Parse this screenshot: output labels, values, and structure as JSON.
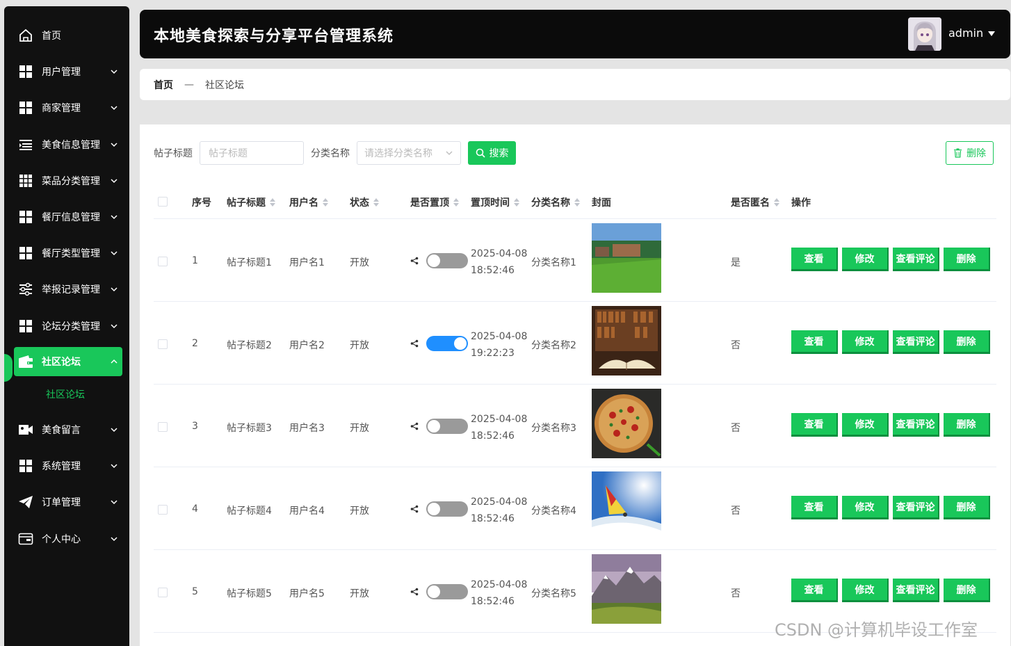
{
  "app": {
    "title": "本地美食探索与分享平台管理系统",
    "username": "admin"
  },
  "sidebar": {
    "items": [
      {
        "label": "首页",
        "icon": "home-icon"
      },
      {
        "label": "用户管理",
        "icon": "grid-icon"
      },
      {
        "label": "商家管理",
        "icon": "grid-icon"
      },
      {
        "label": "美食信息管理",
        "icon": "list-icon"
      },
      {
        "label": "菜品分类管理",
        "icon": "grid-icon"
      },
      {
        "label": "餐厅信息管理",
        "icon": "grid-icon"
      },
      {
        "label": "餐厅类型管理",
        "icon": "grid-icon"
      },
      {
        "label": "举报记录管理",
        "icon": "sliders-icon"
      },
      {
        "label": "论坛分类管理",
        "icon": "grid-icon"
      },
      {
        "label": "社区论坛",
        "icon": "wallet-icon"
      },
      {
        "label": "美食留言",
        "icon": "video-icon"
      },
      {
        "label": "系统管理",
        "icon": "grid-icon"
      },
      {
        "label": "订单管理",
        "icon": "send-icon"
      },
      {
        "label": "个人中心",
        "icon": "card-icon"
      }
    ],
    "sub_item": "社区论坛"
  },
  "breadcrumb": {
    "home": "首页",
    "separator": "—",
    "current": "社区论坛"
  },
  "search": {
    "title_label": "帖子标题",
    "title_placeholder": "帖子标题",
    "category_label": "分类名称",
    "category_placeholder": "请选择分类名称",
    "search_button": "搜索",
    "delete_button": "删除"
  },
  "table": {
    "headers": {
      "index": "序号",
      "title": "帖子标题",
      "username": "用户名",
      "status": "状态",
      "pinned": "是否置顶",
      "pinned_time": "置顶时间",
      "category": "分类名称",
      "cover": "封面",
      "anonymous": "是否匿名",
      "actions": "操作"
    },
    "rows": [
      {
        "index": "1",
        "title": "帖子标题1",
        "username": "用户名1",
        "status": "开放",
        "pinned": false,
        "date": "2025-04-08",
        "time": "18:52:46",
        "category": "分类名称1",
        "anonymous": "是",
        "cover": "campus-lawn"
      },
      {
        "index": "2",
        "title": "帖子标题2",
        "username": "用户名2",
        "status": "开放",
        "pinned": true,
        "date": "2025-04-08",
        "time": "19:22:23",
        "category": "分类名称2",
        "anonymous": "否",
        "cover": "library-book"
      },
      {
        "index": "3",
        "title": "帖子标题3",
        "username": "用户名3",
        "status": "开放",
        "pinned": false,
        "date": "2025-04-08",
        "time": "18:52:46",
        "category": "分类名称3",
        "anonymous": "否",
        "cover": "pizza"
      },
      {
        "index": "4",
        "title": "帖子标题4",
        "username": "用户名4",
        "status": "开放",
        "pinned": false,
        "date": "2025-04-08",
        "time": "18:52:46",
        "category": "分类名称4",
        "anonymous": "否",
        "cover": "windsurf"
      },
      {
        "index": "5",
        "title": "帖子标题5",
        "username": "用户名5",
        "status": "开放",
        "pinned": false,
        "date": "2025-04-08",
        "time": "18:52:46",
        "category": "分类名称5",
        "anonymous": "否",
        "cover": "mountains"
      }
    ],
    "actions": {
      "view": "查看",
      "edit": "修改",
      "comments": "查看评论",
      "delete": "删除"
    }
  },
  "watermark": "CSDN @计算机毕设工作室",
  "colors": {
    "accent": "#19c75a",
    "toggle_on": "#1f8fff",
    "toggle_off": "#9a9a9a",
    "sidebar_bg": "#111111",
    "header_bg": "#0b0b0b"
  }
}
